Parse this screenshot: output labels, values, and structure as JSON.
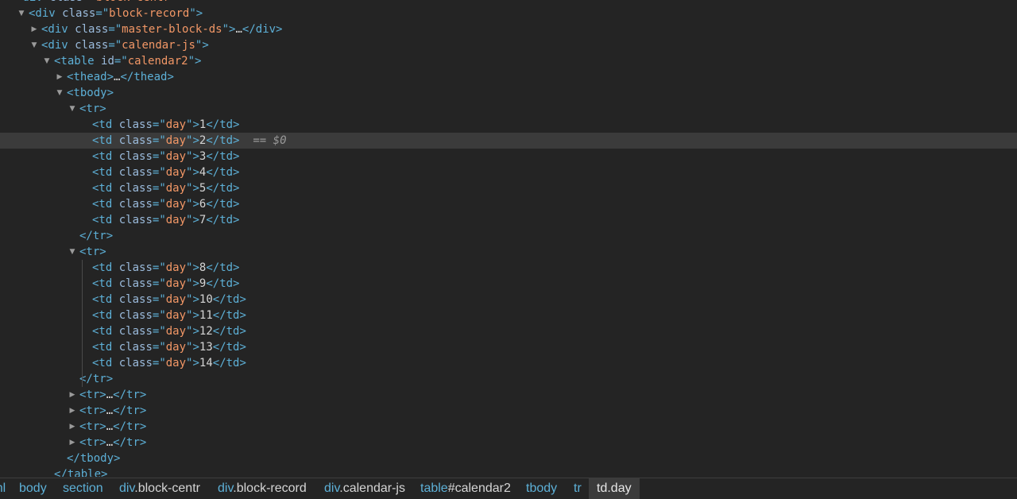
{
  "tree": {
    "rows": [
      {
        "level": 1,
        "toggle": "expanded",
        "parts": [
          [
            "tg",
            "<div"
          ],
          [
            "tx",
            " "
          ],
          [
            "an",
            "class"
          ],
          [
            "tg",
            "=\""
          ],
          [
            "av",
            "block-centr"
          ],
          [
            "tg",
            "\">"
          ]
        ]
      },
      {
        "level": 2,
        "toggle": "expanded",
        "parts": [
          [
            "tg",
            "<div"
          ],
          [
            "tx",
            " "
          ],
          [
            "an",
            "class"
          ],
          [
            "tg",
            "=\""
          ],
          [
            "av",
            "block-record"
          ],
          [
            "tg",
            "\">"
          ]
        ]
      },
      {
        "level": 3,
        "toggle": "collapsed",
        "parts": [
          [
            "tg",
            "<div"
          ],
          [
            "tx",
            " "
          ],
          [
            "an",
            "class"
          ],
          [
            "tg",
            "=\""
          ],
          [
            "av",
            "master-block-ds"
          ],
          [
            "tg",
            "\">"
          ],
          [
            "tx",
            "…"
          ],
          [
            "tg",
            "</div>"
          ]
        ]
      },
      {
        "level": 3,
        "toggle": "expanded",
        "parts": [
          [
            "tg",
            "<div"
          ],
          [
            "tx",
            " "
          ],
          [
            "an",
            "class"
          ],
          [
            "tg",
            "=\""
          ],
          [
            "av",
            "calendar-js"
          ],
          [
            "tg",
            "\">"
          ]
        ]
      },
      {
        "level": 4,
        "toggle": "expanded",
        "parts": [
          [
            "tg",
            "<table"
          ],
          [
            "tx",
            " "
          ],
          [
            "an",
            "id"
          ],
          [
            "tg",
            "=\""
          ],
          [
            "av",
            "calendar2"
          ],
          [
            "tg",
            "\">"
          ]
        ]
      },
      {
        "level": 5,
        "toggle": "collapsed",
        "parts": [
          [
            "tg",
            "<thead>"
          ],
          [
            "tx",
            "…"
          ],
          [
            "tg",
            "</thead>"
          ]
        ]
      },
      {
        "level": 5,
        "toggle": "expanded",
        "parts": [
          [
            "tg",
            "<tbody>"
          ]
        ]
      },
      {
        "level": 6,
        "toggle": "expanded",
        "parts": [
          [
            "tg",
            "<tr>"
          ]
        ]
      },
      {
        "level": 7,
        "toggle": "none",
        "parts": [
          [
            "tg",
            "<td"
          ],
          [
            "tx",
            " "
          ],
          [
            "an",
            "class"
          ],
          [
            "tg",
            "=\""
          ],
          [
            "av",
            "day"
          ],
          [
            "tg",
            "\">"
          ],
          [
            "tx",
            "1"
          ],
          [
            "tg",
            "</td>"
          ]
        ]
      },
      {
        "level": 7,
        "toggle": "none",
        "selected": true,
        "marker": "== $0",
        "parts": [
          [
            "tg",
            "<td"
          ],
          [
            "tx",
            " "
          ],
          [
            "an",
            "class"
          ],
          [
            "tg",
            "=\""
          ],
          [
            "av",
            "day"
          ],
          [
            "tg",
            "\">"
          ],
          [
            "tx",
            "2"
          ],
          [
            "tg",
            "</td>"
          ]
        ]
      },
      {
        "level": 7,
        "toggle": "none",
        "parts": [
          [
            "tg",
            "<td"
          ],
          [
            "tx",
            " "
          ],
          [
            "an",
            "class"
          ],
          [
            "tg",
            "=\""
          ],
          [
            "av",
            "day"
          ],
          [
            "tg",
            "\">"
          ],
          [
            "tx",
            "3"
          ],
          [
            "tg",
            "</td>"
          ]
        ]
      },
      {
        "level": 7,
        "toggle": "none",
        "parts": [
          [
            "tg",
            "<td"
          ],
          [
            "tx",
            " "
          ],
          [
            "an",
            "class"
          ],
          [
            "tg",
            "=\""
          ],
          [
            "av",
            "day"
          ],
          [
            "tg",
            "\">"
          ],
          [
            "tx",
            "4"
          ],
          [
            "tg",
            "</td>"
          ]
        ]
      },
      {
        "level": 7,
        "toggle": "none",
        "parts": [
          [
            "tg",
            "<td"
          ],
          [
            "tx",
            " "
          ],
          [
            "an",
            "class"
          ],
          [
            "tg",
            "=\""
          ],
          [
            "av",
            "day"
          ],
          [
            "tg",
            "\">"
          ],
          [
            "tx",
            "5"
          ],
          [
            "tg",
            "</td>"
          ]
        ]
      },
      {
        "level": 7,
        "toggle": "none",
        "parts": [
          [
            "tg",
            "<td"
          ],
          [
            "tx",
            " "
          ],
          [
            "an",
            "class"
          ],
          [
            "tg",
            "=\""
          ],
          [
            "av",
            "day"
          ],
          [
            "tg",
            "\">"
          ],
          [
            "tx",
            "6"
          ],
          [
            "tg",
            "</td>"
          ]
        ]
      },
      {
        "level": 7,
        "toggle": "none",
        "parts": [
          [
            "tg",
            "<td"
          ],
          [
            "tx",
            " "
          ],
          [
            "an",
            "class"
          ],
          [
            "tg",
            "=\""
          ],
          [
            "av",
            "day"
          ],
          [
            "tg",
            "\">"
          ],
          [
            "tx",
            "7"
          ],
          [
            "tg",
            "</td>"
          ]
        ]
      },
      {
        "level": 6,
        "toggle": "none",
        "parts": [
          [
            "tg",
            "</tr>"
          ]
        ]
      },
      {
        "level": 6,
        "toggle": "expanded",
        "parts": [
          [
            "tg",
            "<tr>"
          ]
        ]
      },
      {
        "level": 7,
        "toggle": "none",
        "parts": [
          [
            "tg",
            "<td"
          ],
          [
            "tx",
            " "
          ],
          [
            "an",
            "class"
          ],
          [
            "tg",
            "=\""
          ],
          [
            "av",
            "day"
          ],
          [
            "tg",
            "\">"
          ],
          [
            "tx",
            "8"
          ],
          [
            "tg",
            "</td>"
          ]
        ]
      },
      {
        "level": 7,
        "toggle": "none",
        "parts": [
          [
            "tg",
            "<td"
          ],
          [
            "tx",
            " "
          ],
          [
            "an",
            "class"
          ],
          [
            "tg",
            "=\""
          ],
          [
            "av",
            "day"
          ],
          [
            "tg",
            "\">"
          ],
          [
            "tx",
            "9"
          ],
          [
            "tg",
            "</td>"
          ]
        ]
      },
      {
        "level": 7,
        "toggle": "none",
        "parts": [
          [
            "tg",
            "<td"
          ],
          [
            "tx",
            " "
          ],
          [
            "an",
            "class"
          ],
          [
            "tg",
            "=\""
          ],
          [
            "av",
            "day"
          ],
          [
            "tg",
            "\">"
          ],
          [
            "tx",
            "10"
          ],
          [
            "tg",
            "</td>"
          ]
        ]
      },
      {
        "level": 7,
        "toggle": "none",
        "parts": [
          [
            "tg",
            "<td"
          ],
          [
            "tx",
            " "
          ],
          [
            "an",
            "class"
          ],
          [
            "tg",
            "=\""
          ],
          [
            "av",
            "day"
          ],
          [
            "tg",
            "\">"
          ],
          [
            "tx",
            "11"
          ],
          [
            "tg",
            "</td>"
          ]
        ]
      },
      {
        "level": 7,
        "toggle": "none",
        "parts": [
          [
            "tg",
            "<td"
          ],
          [
            "tx",
            " "
          ],
          [
            "an",
            "class"
          ],
          [
            "tg",
            "=\""
          ],
          [
            "av",
            "day"
          ],
          [
            "tg",
            "\">"
          ],
          [
            "tx",
            "12"
          ],
          [
            "tg",
            "</td>"
          ]
        ]
      },
      {
        "level": 7,
        "toggle": "none",
        "parts": [
          [
            "tg",
            "<td"
          ],
          [
            "tx",
            " "
          ],
          [
            "an",
            "class"
          ],
          [
            "tg",
            "=\""
          ],
          [
            "av",
            "day"
          ],
          [
            "tg",
            "\">"
          ],
          [
            "tx",
            "13"
          ],
          [
            "tg",
            "</td>"
          ]
        ]
      },
      {
        "level": 7,
        "toggle": "none",
        "parts": [
          [
            "tg",
            "<td"
          ],
          [
            "tx",
            " "
          ],
          [
            "an",
            "class"
          ],
          [
            "tg",
            "=\""
          ],
          [
            "av",
            "day"
          ],
          [
            "tg",
            "\">"
          ],
          [
            "tx",
            "14"
          ],
          [
            "tg",
            "</td>"
          ]
        ]
      },
      {
        "level": 6,
        "toggle": "none",
        "parts": [
          [
            "tg",
            "</tr>"
          ]
        ]
      },
      {
        "level": 6,
        "toggle": "collapsed",
        "parts": [
          [
            "tg",
            "<tr>"
          ],
          [
            "tx",
            "…"
          ],
          [
            "tg",
            "</tr>"
          ]
        ]
      },
      {
        "level": 6,
        "toggle": "collapsed",
        "parts": [
          [
            "tg",
            "<tr>"
          ],
          [
            "tx",
            "…"
          ],
          [
            "tg",
            "</tr>"
          ]
        ]
      },
      {
        "level": 6,
        "toggle": "collapsed",
        "parts": [
          [
            "tg",
            "<tr>"
          ],
          [
            "tx",
            "…"
          ],
          [
            "tg",
            "</tr>"
          ]
        ]
      },
      {
        "level": 6,
        "toggle": "collapsed",
        "parts": [
          [
            "tg",
            "<tr>"
          ],
          [
            "tx",
            "…"
          ],
          [
            "tg",
            "</tr>"
          ]
        ]
      },
      {
        "level": 5,
        "toggle": "none",
        "parts": [
          [
            "tg",
            "</tbody>"
          ]
        ]
      },
      {
        "level": 4,
        "toggle": "none",
        "parts": [
          [
            "tg",
            "</table>"
          ]
        ]
      }
    ]
  },
  "breadcrumbs": [
    {
      "tag": "html",
      "rest": "",
      "current": false
    },
    {
      "tag": "body",
      "rest": "",
      "current": false
    },
    {
      "tag": "section",
      "rest": "",
      "current": false
    },
    {
      "tag": "div",
      "rest": ".block-centr",
      "current": false
    },
    {
      "tag": "div",
      "rest": ".block-record",
      "current": false
    },
    {
      "tag": "div",
      "rest": ".calendar-js",
      "current": false
    },
    {
      "tag": "table",
      "rest": "#calendar2",
      "current": false
    },
    {
      "tag": "tbody",
      "rest": "",
      "current": false
    },
    {
      "tag": "tr",
      "rest": "",
      "current": false
    },
    {
      "tag": "td",
      "rest": ".day",
      "current": true
    }
  ],
  "colors": {
    "background": "#242424",
    "tag": "#5db0d7",
    "attr_name": "#9bbbdc",
    "attr_value": "#f29766",
    "text": "#d5d5d5",
    "selection": "#3b3b3b"
  },
  "icons": {
    "expanded": "triangle-down-icon",
    "collapsed": "triangle-right-icon"
  }
}
